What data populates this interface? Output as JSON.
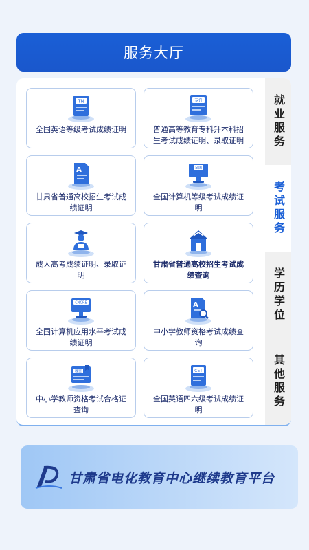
{
  "header": {
    "title": "服务大厅"
  },
  "cards": [
    {
      "label": "全国英语等级考试成绩证明",
      "icon": "pets-document-icon",
      "badge": "TN"
    },
    {
      "label": "普通高等教育专科升本科招生考试成绩证明、录取证明",
      "icon": "upgrade-exam-icon",
      "badge": "专升"
    },
    {
      "label": "甘肃省普通高校招生考试成绩证明",
      "icon": "document-a-icon",
      "badge": "A"
    },
    {
      "label": "全国计算机等级考试成绩证明",
      "icon": "computer-exam-icon",
      "badge": "全国"
    },
    {
      "label": "成人高考成绩证明、录取证明",
      "icon": "graduate-person-icon",
      "badge": ""
    },
    {
      "label": "甘肃省普通高校招生考试成绩查询",
      "icon": "school-building-icon",
      "badge": ""
    },
    {
      "label": "全国计算机应用水平考试成绩证明",
      "icon": "nit-computer-icon",
      "badge": "CNCRE"
    },
    {
      "label": "中小学教师资格考试成绩查询",
      "icon": "document-search-icon",
      "badge": "A"
    },
    {
      "label": "中小学教师资格考试合格证查询",
      "icon": "teacher-certificate-icon",
      "badge": "教资"
    },
    {
      "label": "全国英语四六级考试成绩证明",
      "icon": "cet-document-icon",
      "badge": "CET"
    }
  ],
  "tabs": [
    {
      "label": "就业服务",
      "active": false
    },
    {
      "label": "考试服务",
      "active": true
    },
    {
      "label": "学历学位",
      "active": false
    },
    {
      "label": "其他服务",
      "active": false
    }
  ],
  "banner": {
    "text": "甘肃省电化教育中心继续教育平台"
  },
  "colors": {
    "primary": "#1a5fd6",
    "card_border": "#b8cdec",
    "text": "#1d2c6b"
  }
}
